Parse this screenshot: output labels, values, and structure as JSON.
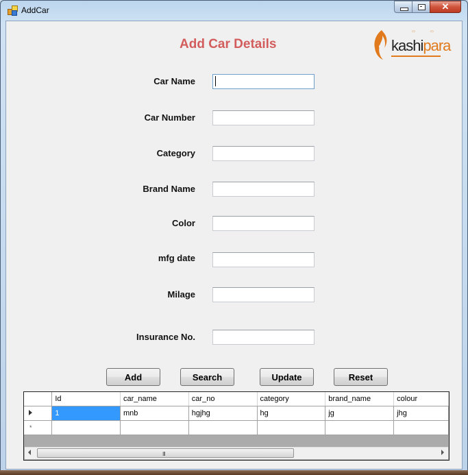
{
  "window": {
    "title": "AddCar",
    "controls": {
      "minimize": "minimize",
      "maximize": "maximize",
      "close": "close"
    }
  },
  "form": {
    "heading": "Add Car Details",
    "logo": {
      "text_main": "kashi",
      "text_accent": "para",
      "accent_color": "#e07a1c"
    },
    "fields": [
      {
        "label": "Car Name",
        "value": "",
        "focused": true
      },
      {
        "label": "Car Number",
        "value": ""
      },
      {
        "label": "Category",
        "value": ""
      },
      {
        "label": "Brand Name",
        "value": ""
      },
      {
        "label": "Color",
        "value": ""
      },
      {
        "label": "mfg date",
        "value": ""
      },
      {
        "label": "Milage",
        "value": ""
      },
      {
        "label": "Insurance No.",
        "value": ""
      }
    ],
    "buttons": {
      "add": "Add",
      "search": "Search",
      "update": "Update",
      "reset": "Reset"
    }
  },
  "grid": {
    "columns": [
      "Id",
      "car_name",
      "car_no",
      "category",
      "brand_name",
      "colour"
    ],
    "rows": [
      [
        "1",
        "mnb",
        "hgjhg",
        "hg",
        "jg",
        "jhg"
      ]
    ],
    "new_row_marker": "*",
    "scrollbar_grip": "III"
  },
  "colors": {
    "heading": "#d35c5c",
    "selection": "#3399ff"
  }
}
